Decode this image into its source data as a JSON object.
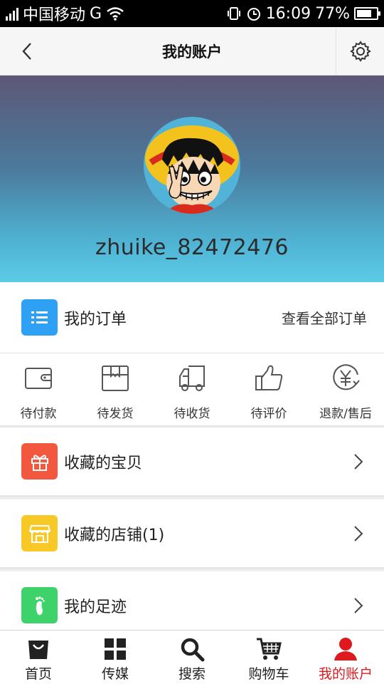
{
  "status_bar": {
    "carrier": "中国移动",
    "network": "G",
    "time": "16:09",
    "battery": "77%",
    "battery_level": 0.77
  },
  "nav": {
    "title": "我的账户",
    "back_icon": "chevron-left-icon",
    "settings_icon": "gear-icon"
  },
  "profile": {
    "username": "zhuike_82472476",
    "avatar": "cartoon-avatar"
  },
  "orders": {
    "title": "我的订单",
    "view_all": "查看全部订单",
    "icon_color": "#2ea1f5",
    "states": [
      {
        "label": "待付款",
        "icon": "wallet-icon"
      },
      {
        "label": "待发货",
        "icon": "package-icon"
      },
      {
        "label": "待收货",
        "icon": "truck-icon"
      },
      {
        "label": "待评价",
        "icon": "thumbs-up-icon"
      },
      {
        "label": "退款/售后",
        "icon": "refund-yen-icon"
      }
    ]
  },
  "menu": [
    {
      "label": "收藏的宝贝",
      "icon": "gift-icon",
      "color": "#f2583e"
    },
    {
      "label": "收藏的店铺(1)",
      "icon": "store-icon",
      "color": "#f8c926"
    },
    {
      "label": "我的足迹",
      "icon": "footprint-icon",
      "color": "#3ed26a"
    }
  ],
  "tabbar": {
    "active_color": "#e0191f",
    "tabs": [
      {
        "label": "首页",
        "icon": "shopping-bag-icon"
      },
      {
        "label": "传媒",
        "icon": "grid-icon"
      },
      {
        "label": "搜索",
        "icon": "search-icon"
      },
      {
        "label": "购物车",
        "icon": "cart-icon"
      },
      {
        "label": "我的账户",
        "icon": "user-icon"
      }
    ]
  }
}
